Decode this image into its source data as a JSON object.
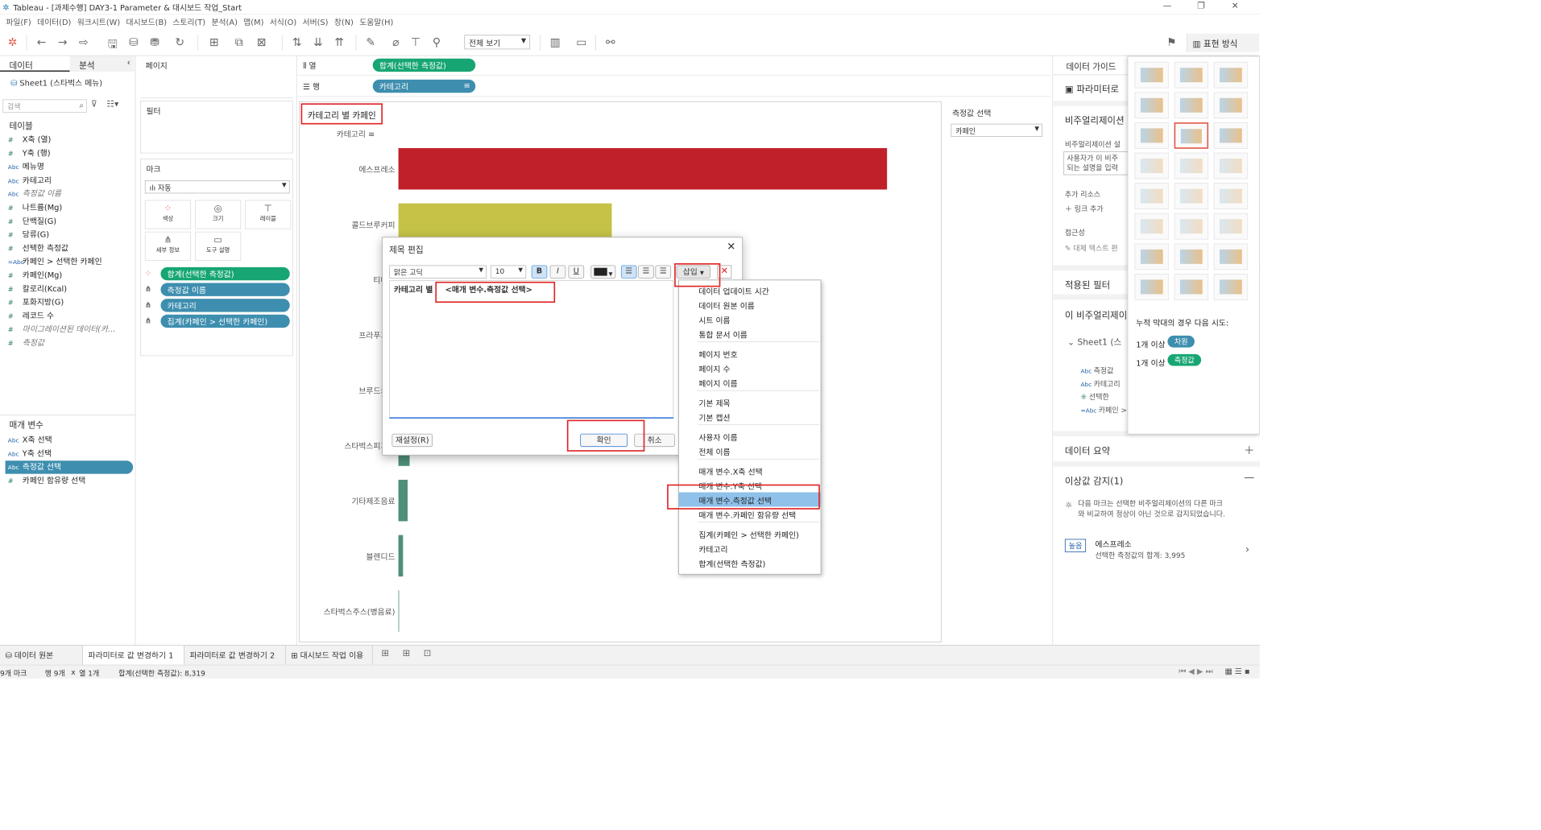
{
  "window": {
    "title": "Tableau - [과제수행] DAY3-1 Parameter & 대시보드 작업_Start"
  },
  "menu": [
    "파일(F)",
    "데이터(D)",
    "워크시트(W)",
    "대시보드(B)",
    "스토리(T)",
    "분석(A)",
    "맵(M)",
    "서식(O)",
    "서버(S)",
    "창(N)",
    "도움말(H)"
  ],
  "toolbar": {
    "view_select": "전체 보기",
    "show_me": "표현 방식"
  },
  "datapane": {
    "tab_data": "데이터",
    "tab_analysis": "분석",
    "source": "Sheet1 (스타벅스 메뉴)",
    "search_placeholder": "검색",
    "tables_header": "테이블",
    "fields": [
      {
        "type": "#",
        "name": "X축 (열)"
      },
      {
        "type": "#",
        "name": "Y축 (행)"
      },
      {
        "type": "Abc",
        "name": "메뉴명"
      },
      {
        "type": "Abc",
        "name": "카테고리"
      },
      {
        "type": "Abc",
        "name": "측정값 이름",
        "italic": true
      },
      {
        "type": "#",
        "name": "나트륨(Mg)"
      },
      {
        "type": "#",
        "name": "단백질(G)"
      },
      {
        "type": "#",
        "name": "당류(G)"
      },
      {
        "type": "#",
        "name": "선택한 측정값"
      },
      {
        "type": "=Abc",
        "name": "카페인 > 선택한 카페인"
      },
      {
        "type": "#",
        "name": "카페인(Mg)"
      },
      {
        "type": "#",
        "name": "칼로리(Kcal)"
      },
      {
        "type": "#",
        "name": "포화지방(G)"
      },
      {
        "type": "#",
        "name": "레코드 수"
      },
      {
        "type": "#",
        "name": "마이그레이션된 데이터(카...",
        "italic": true
      },
      {
        "type": "#",
        "name": "측정값",
        "italic": true
      }
    ],
    "params_header": "매개 변수",
    "params": [
      {
        "type": "Abc",
        "name": "X축 선택"
      },
      {
        "type": "Abc",
        "name": "Y축 선택"
      },
      {
        "type": "Abc",
        "name": "측정값 선택",
        "selected": true
      },
      {
        "type": "#",
        "name": "카페인 함유량 선택"
      }
    ]
  },
  "shelves": {
    "pages": "페이지",
    "filters": "필터",
    "marks": "마크",
    "mark_type": "자동",
    "mark_buttons": [
      "색상",
      "크기",
      "레이블",
      "세부 정보",
      "도구 설명"
    ],
    "mark_pills": [
      "합계(선택한 측정값)",
      "측정값 이름",
      "카테고리",
      "집계(카페인 > 선택한 카페인)"
    ],
    "columns_label": "열",
    "rows_label": "행",
    "columns_pill": "합계(선택한 측정값)",
    "rows_pill": "카테고리"
  },
  "view": {
    "sheet_title": "카테고리 별 카페인",
    "col_header": "카테고리",
    "param_title": "측정값 선택",
    "param_value": "카페인"
  },
  "chart_data": {
    "type": "bar",
    "categories": [
      "에스프레소",
      "콜드브루커피",
      "티바나",
      "프라푸치노",
      "브루드커피",
      "스타벅스피지오",
      "기타제조음료",
      "블렌디드",
      "스타벅스주스(병음료)"
    ],
    "values": [
      3995,
      1745,
      0,
      0,
      0,
      90,
      75,
      40,
      5
    ],
    "colors": [
      "#c0202a",
      "#c5c247",
      "#4e8f7a",
      "#4e8f7a",
      "#4e8f7a",
      "#4e8f7a",
      "#4e8f7a",
      "#4e8f7a",
      "#4e8f7a"
    ],
    "xlim": [
      0,
      4200
    ]
  },
  "dialog": {
    "title": "제목 편집",
    "font": "맑은 고딕",
    "size": "10",
    "b": "B",
    "i": "I",
    "u": "U",
    "insert": "삽입",
    "text_prefix": "카테고리 별",
    "text_token": "<매개 변수.측정값 선택>",
    "reset": "재설정(R)",
    "ok": "확인",
    "cancel": "취소"
  },
  "insert_menu": {
    "groups": [
      [
        "데이터 업데이트 시간",
        "데이터 원본 이름",
        "시트 이름",
        "통합 문서 이름"
      ],
      [
        "페이지 번호",
        "페이지 수",
        "페이지 이름"
      ],
      [
        "기본 제목",
        "기본 캡션"
      ],
      [
        "사용자 이름",
        "전체 이름"
      ],
      [
        "매개 변수.X축 선택",
        "매개 변수.Y축 선택",
        "매개 변수.측정값 선택",
        "매개 변수.카페인 함유량 선택"
      ],
      [
        "집계(카페인 > 선택한 카페인)",
        "카테고리",
        "합계(선택한 측정값)"
      ]
    ],
    "highlighted": "매개 변수.측정값 선택"
  },
  "guide": {
    "title": "데이터 가이드",
    "param": "파라미터로",
    "viz_desc": "비주얼리제이션",
    "viz_desc_sub": "비주얼리제이션 설",
    "viz_input": "사용자가 이 비주",
    "viz_input2": "되는 설명을 입력",
    "resources": "추가 리소스",
    "add_link": "링크 추가",
    "access": "접근성",
    "alt_text": "대체 텍스트 편",
    "filters": "적용된 필터",
    "this_viz": "이 비주얼리제이",
    "sheet1": "Sheet1 (스",
    "fields": [
      "측정값",
      "카테고리",
      "선택한",
      "카페인 >"
    ],
    "summary": "데이터 요약",
    "anomaly": "이상값 감지(1)",
    "anomaly_desc1": "다음 마크는 선택한 비주얼리제이션의 다른 마크",
    "anomaly_desc2": "와 비교하여 정상이 아닌 것으로 감지되었습니다.",
    "badge": "높음",
    "anomaly_item": "에스프레소",
    "anomaly_value": "선택한 측정값의 합계: 3,995"
  },
  "showme": {
    "hint": "누적 막대의 경우 다음 시도:",
    "line1_prefix": "1개 이상",
    "line1_pill": "차원",
    "line2_prefix": "1개 이상",
    "line2_pill": "측정값"
  },
  "tabs": [
    "데이터 원본",
    "파라미터로 값 변경하기 1",
    "파라미터로 값 변경하기 2",
    "대시보드 작업 이용"
  ],
  "status": {
    "marks": "9개 마크",
    "rows": "행 9개",
    "x": "x",
    "cols": "열 1개",
    "sum": "합계(선택한 측정값): 8,319"
  }
}
